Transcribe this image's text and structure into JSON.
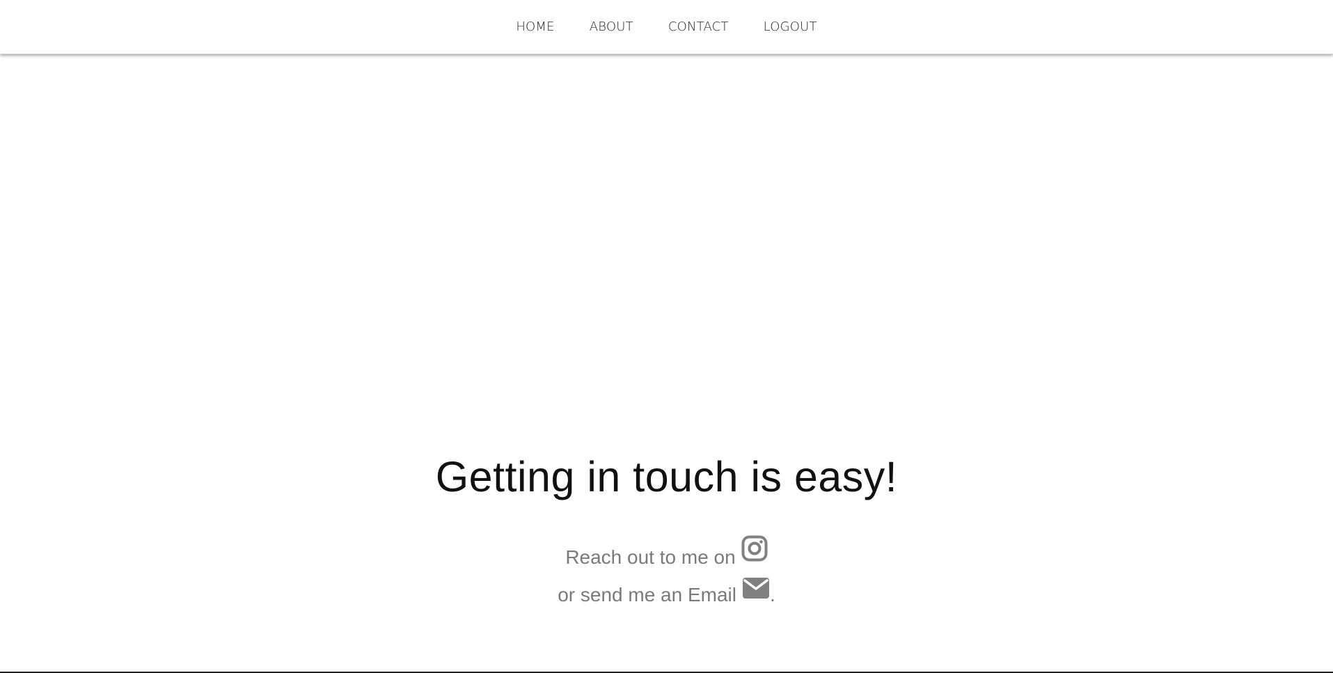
{
  "nav": {
    "items": [
      {
        "label": "HOME"
      },
      {
        "label": "ABOUT"
      },
      {
        "label": "CONTACT"
      },
      {
        "label": "LOGOUT"
      }
    ]
  },
  "hero": {
    "title": "Getting in touch is easy!"
  },
  "contact": {
    "line1_text": "Reach out to me on",
    "line1_icon": "instagram-icon",
    "line2_text": "or send me an Email",
    "line2_icon": "email-icon",
    "line2_suffix": "."
  },
  "colors": {
    "nav_text": "#222222",
    "title_text": "#111111",
    "body_text": "#7a7a7a",
    "icon": "#808080",
    "background": "#ffffff"
  }
}
